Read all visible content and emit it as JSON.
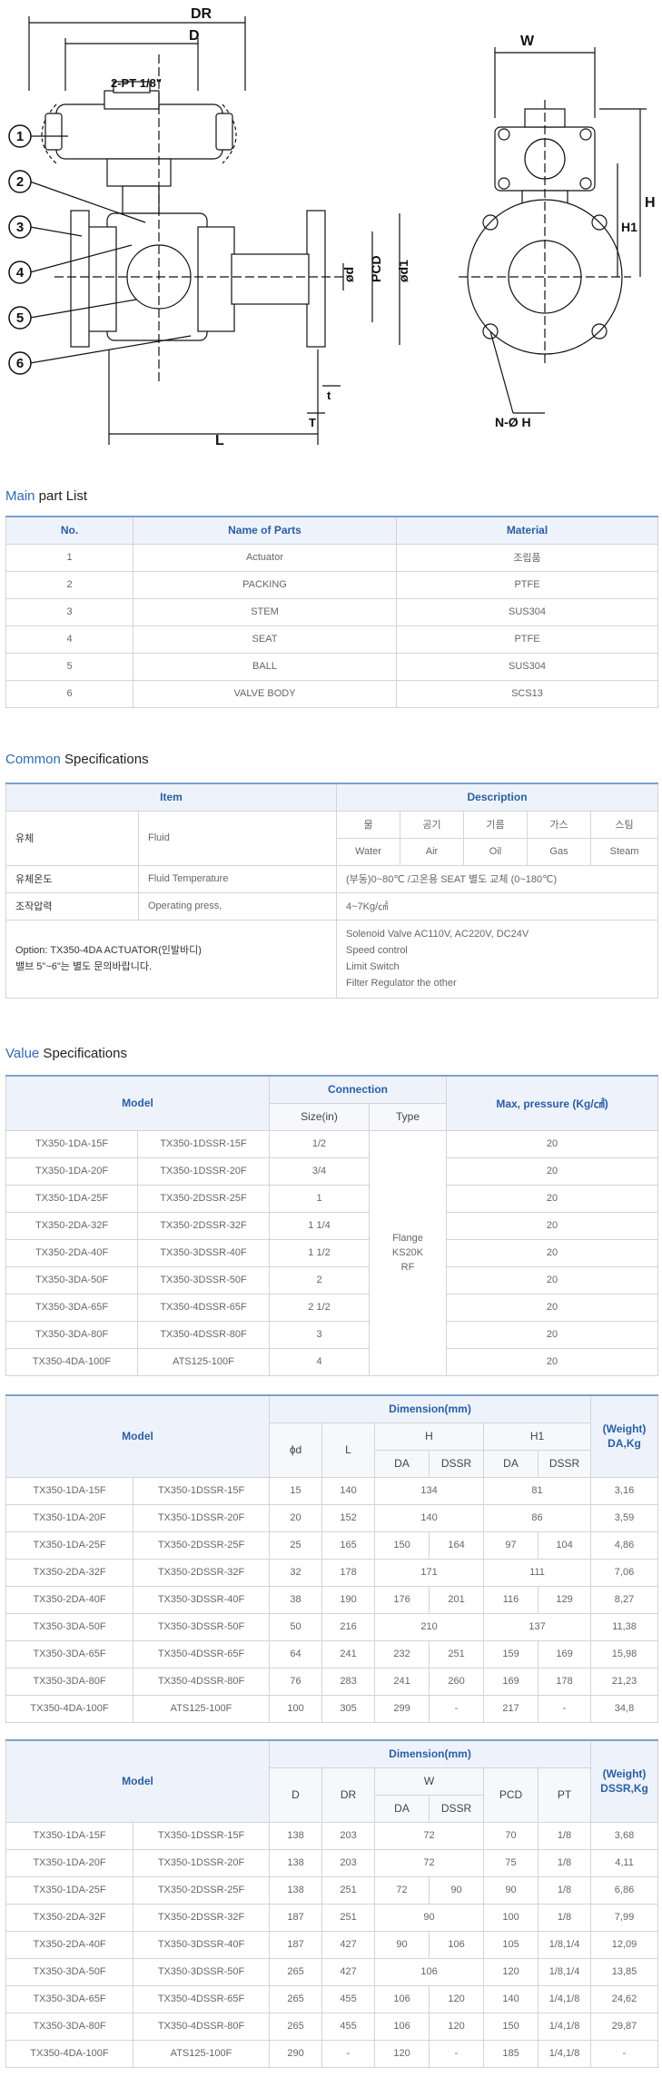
{
  "drawing": {
    "labels": {
      "dr": "DR",
      "d": "D",
      "pt": "2-PT 1/8\"",
      "w": "W",
      "h": "H",
      "h1": "H1",
      "pcd": "PCD",
      "phi_d": "ød",
      "phi_d1": "ød1",
      "l": "L",
      "t_small": "t",
      "t_big": "T",
      "noh": "N-Ø H",
      "callouts": [
        "1",
        "2",
        "3",
        "4",
        "5",
        "6"
      ]
    }
  },
  "parts": {
    "title_hl": "Main",
    "title_rest": " part List",
    "headers": [
      "No.",
      "Name of Parts",
      "Material"
    ],
    "rows": [
      {
        "no": "1",
        "name": "Actuator",
        "material": "조립품"
      },
      {
        "no": "2",
        "name": "PACKING",
        "material": "PTFE"
      },
      {
        "no": "3",
        "name": "STEM",
        "material": "SUS304"
      },
      {
        "no": "4",
        "name": "SEAT",
        "material": "PTFE"
      },
      {
        "no": "5",
        "name": "BALL",
        "material": "SUS304"
      },
      {
        "no": "6",
        "name": "VALVE BODY",
        "material": "SCS13"
      }
    ]
  },
  "common": {
    "title_hl": "Common",
    "title_rest": " Specifications",
    "headers": [
      "Item",
      "Description"
    ],
    "media_kr": [
      "물",
      "공기",
      "기름",
      "가스",
      "스팀"
    ],
    "media_en": [
      "Water",
      "Air",
      "Oil",
      "Gas",
      "Steam"
    ],
    "fluid_kr": "유체",
    "fluid_en": "Fluid",
    "temp_kr": "유체온도",
    "temp_en": "Fluid Temperature",
    "temp_val": "(부동)0~80℃ /고온용 SEAT 별도 교체 (0~180℃)",
    "press_kr": "조작압력",
    "press_en": "Operating press,",
    "press_val": "4~7Kg/㎠",
    "option_line1": "Option: TX350-4DA ACTUATOR(인발바디)",
    "option_line2": "밸브 5\"~6\"는 별도 문의바랍니다.",
    "option_vals": [
      "Solenoid Valve AC110V, AC220V, DC24V",
      "Speed control",
      "Limit Switch",
      "Filter Regulator the other"
    ]
  },
  "value": {
    "title_hl": "Value",
    "title_rest": " Specifications",
    "t1": {
      "h_model": "Model",
      "h_conn": "Connection",
      "h_size": "Size(in)",
      "h_type": "Type",
      "h_press": "Max, pressure (Kg/㎠)",
      "type_val": [
        "Flange",
        "KS20K",
        "RF"
      ],
      "rows": [
        {
          "m1": "TX350-1DA-15F",
          "m2": "TX350-1DSSR-15F",
          "size": "1/2",
          "press": "20"
        },
        {
          "m1": "TX350-1DA-20F",
          "m2": "TX350-1DSSR-20F",
          "size": "3/4",
          "press": "20"
        },
        {
          "m1": "TX350-1DA-25F",
          "m2": "TX350-2DSSR-25F",
          "size": "1",
          "press": "20"
        },
        {
          "m1": "TX350-2DA-32F",
          "m2": "TX350-2DSSR-32F",
          "size": "1 1/4",
          "press": "20"
        },
        {
          "m1": "TX350-2DA-40F",
          "m2": "TX350-3DSSR-40F",
          "size": "1 1/2",
          "press": "20"
        },
        {
          "m1": "TX350-3DA-50F",
          "m2": "TX350-3DSSR-50F",
          "size": "2",
          "press": "20"
        },
        {
          "m1": "TX350-3DA-65F",
          "m2": "TX350-4DSSR-65F",
          "size": "2 1/2",
          "press": "20"
        },
        {
          "m1": "TX350-3DA-80F",
          "m2": "TX350-4DSSR-80F",
          "size": "3",
          "press": "20"
        },
        {
          "m1": "TX350-4DA-100F",
          "m2": "ATS125-100F",
          "size": "4",
          "press": "20"
        }
      ]
    },
    "t2": {
      "h_model": "Model",
      "h_dim": "Dimension(mm)",
      "h_phid": "ϕd",
      "h_l": "L",
      "h_h": "H",
      "h_h1": "H1",
      "h_da": "DA",
      "h_dssr": "DSSR",
      "h_weight1": "(Weight)",
      "h_weight2": "DA,Kg",
      "rows": [
        {
          "m1": "TX350-1DA-15F",
          "m2": "TX350-1DSSR-15F",
          "d": "15",
          "l": "140",
          "h": "134",
          "h1": "81",
          "wt": "3,16"
        },
        {
          "m1": "TX350-1DA-20F",
          "m2": "TX350-1DSSR-20F",
          "d": "20",
          "l": "152",
          "h": "140",
          "h1": "86",
          "wt": "3,59"
        },
        {
          "m1": "TX350-1DA-25F",
          "m2": "TX350-2DSSR-25F",
          "d": "25",
          "l": "165",
          "h_da": "150",
          "h_dssr": "164",
          "h1_da": "97",
          "h1_dssr": "104",
          "wt": "4,86"
        },
        {
          "m1": "TX350-2DA-32F",
          "m2": "TX350-2DSSR-32F",
          "d": "32",
          "l": "178",
          "h": "171",
          "h1": "111",
          "wt": "7,06"
        },
        {
          "m1": "TX350-2DA-40F",
          "m2": "TX350-3DSSR-40F",
          "d": "38",
          "l": "190",
          "h_da": "176",
          "h_dssr": "201",
          "h1_da": "116",
          "h1_dssr": "129",
          "wt": "8,27"
        },
        {
          "m1": "TX350-3DA-50F",
          "m2": "TX350-3DSSR-50F",
          "d": "50",
          "l": "216",
          "h": "210",
          "h1": "137",
          "wt": "11,38"
        },
        {
          "m1": "TX350-3DA-65F",
          "m2": "TX350-4DSSR-65F",
          "d": "64",
          "l": "241",
          "h_da": "232",
          "h_dssr": "251",
          "h1_da": "159",
          "h1_dssr": "169",
          "wt": "15,98"
        },
        {
          "m1": "TX350-3DA-80F",
          "m2": "TX350-4DSSR-80F",
          "d": "76",
          "l": "283",
          "h_da": "241",
          "h_dssr": "260",
          "h1_da": "169",
          "h1_dssr": "178",
          "wt": "21,23"
        },
        {
          "m1": "TX350-4DA-100F",
          "m2": "ATS125-100F",
          "d": "100",
          "l": "305",
          "h_da": "299",
          "h_dssr": "-",
          "h1_da": "217",
          "h1_dssr": "-",
          "wt": "34,8"
        }
      ]
    },
    "t3": {
      "h_model": "Model",
      "h_dim": "Dimension(mm)",
      "h_d": "D",
      "h_dr": "DR",
      "h_w": "W",
      "h_da": "DA",
      "h_dssr": "DSSR",
      "h_pcd": "PCD",
      "h_pt": "PT",
      "h_weight1": "(Weight)",
      "h_weight2": "DSSR,Kg",
      "rows": [
        {
          "m1": "TX350-1DA-15F",
          "m2": "TX350-1DSSR-15F",
          "d": "138",
          "dr": "203",
          "w": "72",
          "pcd": "70",
          "pt": "1/8",
          "wt": "3,68"
        },
        {
          "m1": "TX350-1DA-20F",
          "m2": "TX350-1DSSR-20F",
          "d": "138",
          "dr": "203",
          "w": "72",
          "pcd": "75",
          "pt": "1/8",
          "wt": "4,11"
        },
        {
          "m1": "TX350-1DA-25F",
          "m2": "TX350-2DSSR-25F",
          "d": "138",
          "dr": "251",
          "w_da": "72",
          "w_dssr": "90",
          "pcd": "90",
          "pt": "1/8",
          "wt": "6,86"
        },
        {
          "m1": "TX350-2DA-32F",
          "m2": "TX350-2DSSR-32F",
          "d": "187",
          "dr": "251",
          "w": "90",
          "pcd": "100",
          "pt": "1/8",
          "wt": "7,99"
        },
        {
          "m1": "TX350-2DA-40F",
          "m2": "TX350-3DSSR-40F",
          "d": "187",
          "dr": "427",
          "w_da": "90",
          "w_dssr": "106",
          "pcd": "105",
          "pt": "1/8,1/4",
          "wt": "12,09"
        },
        {
          "m1": "TX350-3DA-50F",
          "m2": "TX350-3DSSR-50F",
          "d": "265",
          "dr": "427",
          "w": "106",
          "pcd": "120",
          "pt": "1/8,1/4",
          "wt": "13,85"
        },
        {
          "m1": "TX350-3DA-65F",
          "m2": "TX350-4DSSR-65F",
          "d": "265",
          "dr": "455",
          "w_da": "106",
          "w_dssr": "120",
          "pcd": "140",
          "pt": "1/4,1/8",
          "wt": "24,62"
        },
        {
          "m1": "TX350-3DA-80F",
          "m2": "TX350-4DSSR-80F",
          "d": "265",
          "dr": "455",
          "w_da": "106",
          "w_dssr": "120",
          "pcd": "150",
          "pt": "1/4,1/8",
          "wt": "29,87"
        },
        {
          "m1": "TX350-4DA-100F",
          "m2": "ATS125-100F",
          "d": "290",
          "dr": "-",
          "w_da": "120",
          "w_dssr": "-",
          "pcd": "185",
          "pt": "1/4,1/8",
          "wt": "-"
        }
      ]
    }
  }
}
